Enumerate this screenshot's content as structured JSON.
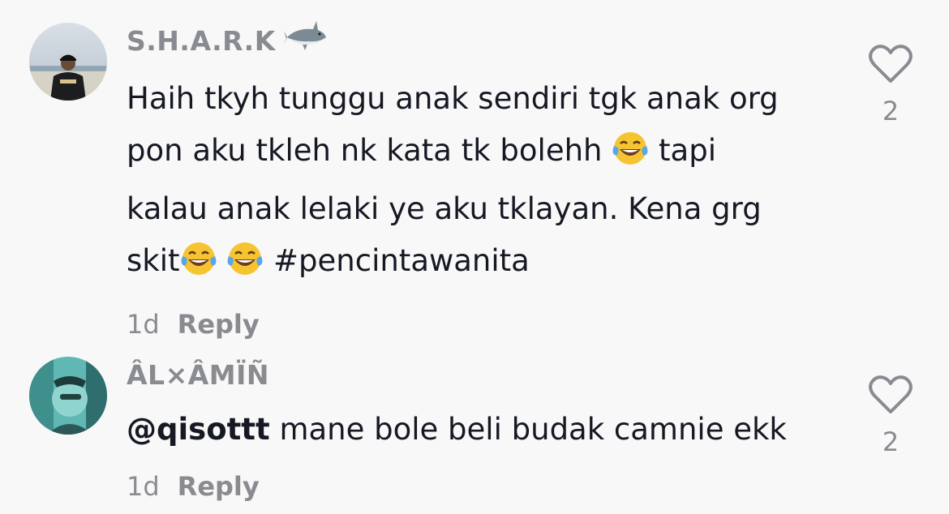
{
  "comments": [
    {
      "username": "S.H.A.R.K",
      "username_emoji_icon": "shark-icon",
      "text_line1": "Haih tkyh tunggu anak sendiri tgk anak org",
      "text_line2a": "pon aku tkleh nk kata tk bolehh",
      "text_line2b": "tapi",
      "text_line3": "kalau anak lelaki ye aku tklayan. Kena grg",
      "text_line4a": "skit",
      "text_line4b": "#pencintawanita",
      "time": "1d",
      "reply_label": "Reply",
      "likes": "2"
    },
    {
      "username": "ÂL×ÂMÏÑ",
      "mention": "@qisottt",
      "text": "mane bole beli budak camnie ekk",
      "time": "1d",
      "reply_label": "Reply",
      "likes": "2"
    }
  ],
  "colors": {
    "background": "#f8f8f8",
    "text": "#161823",
    "muted": "#8a8b91"
  }
}
